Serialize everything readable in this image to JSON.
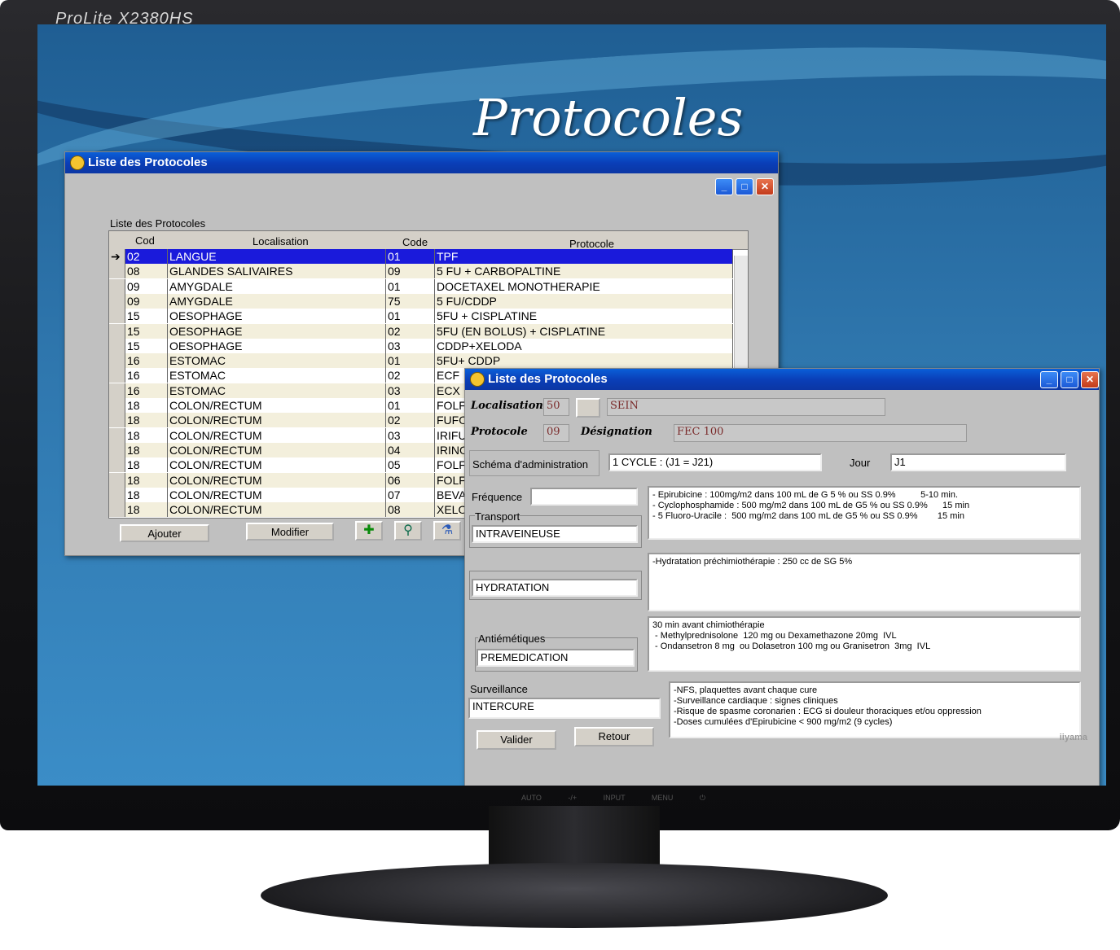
{
  "monitor": {
    "brand": "ProLite X2380HS",
    "vendor": "iiyama",
    "controls": "AUTO -/+ INPUT MENU ⏻"
  },
  "screen": {
    "title": "Protocoles"
  },
  "list_window": {
    "title": "Liste des Protocoles",
    "group_label": "Liste des Protocoles",
    "columns": [
      "Cod",
      "Localisation",
      "Code",
      "Protocole"
    ],
    "rows": [
      {
        "code": "02",
        "localisation": "LANGUE",
        "code2": "01",
        "protocole": "TPF",
        "selected": true
      },
      {
        "code": "08",
        "localisation": "GLANDES SALIVAIRES",
        "code2": "09",
        "protocole": "5 FU + CARBOPALTINE"
      },
      {
        "code": "09",
        "localisation": "AMYGDALE",
        "code2": "01",
        "protocole": "DOCETAXEL MONOTHERAPIE"
      },
      {
        "code": "09",
        "localisation": "AMYGDALE",
        "code2": "75",
        "protocole": "5 FU/CDDP"
      },
      {
        "code": "15",
        "localisation": "OESOPHAGE",
        "code2": "01",
        "protocole": "5FU + CISPLATINE"
      },
      {
        "code": "15",
        "localisation": "OESOPHAGE",
        "code2": "02",
        "protocole": "5FU (EN BOLUS) + CISPLATINE"
      },
      {
        "code": "15",
        "localisation": "OESOPHAGE",
        "code2": "03",
        "protocole": "CDDP+XELODA"
      },
      {
        "code": "16",
        "localisation": "ESTOMAC",
        "code2": "01",
        "protocole": "5FU+ CDDP"
      },
      {
        "code": "16",
        "localisation": "ESTOMAC",
        "code2": "02",
        "protocole": "ECF"
      },
      {
        "code": "16",
        "localisation": "ESTOMAC",
        "code2": "03",
        "protocole": "ECX"
      },
      {
        "code": "18",
        "localisation": "COLON/RECTUM",
        "code2": "01",
        "protocole": "FOLFO"
      },
      {
        "code": "18",
        "localisation": "COLON/RECTUM",
        "code2": "02",
        "protocole": "FUFO"
      },
      {
        "code": "18",
        "localisation": "COLON/RECTUM",
        "code2": "03",
        "protocole": "IRIFU"
      },
      {
        "code": "18",
        "localisation": "COLON/RECTUM",
        "code2": "04",
        "protocole": "IRINO"
      },
      {
        "code": "18",
        "localisation": "COLON/RECTUM",
        "code2": "05",
        "protocole": "FOLFO"
      },
      {
        "code": "18",
        "localisation": "COLON/RECTUM",
        "code2": "06",
        "protocole": "FOLFO"
      },
      {
        "code": "18",
        "localisation": "COLON/RECTUM",
        "code2": "07",
        "protocole": "BEVA"
      },
      {
        "code": "18",
        "localisation": "COLON/RECTUM",
        "code2": "08",
        "protocole": "XELO"
      }
    ],
    "buttons": {
      "add": "Ajouter",
      "modify": "Modifier"
    },
    "icons": [
      "add-icon",
      "filter-icon",
      "flask-icon"
    ]
  },
  "detail_window": {
    "title": "Liste des Protocoles",
    "localisation_label": "Localisation",
    "localisation_code": "50",
    "localisation_name": "SEIN",
    "protocole_label": "Protocole",
    "protocole_code": "09",
    "designation_label": "Désignation",
    "designation": "FEC 100",
    "schema_label": "Schéma d'administration",
    "schema_value": "1 CYCLE : (J1 = J21)",
    "jour_label": "Jour",
    "jour_value": "J1",
    "frequence_label": "Fréquence",
    "frequence_value": "",
    "transport_label": "Transport",
    "transport_value": "INTRAVEINEUSE",
    "hydratation_value": "HYDRATATION",
    "antiemetiques_label": "Antiémétiques",
    "antiemetiques_value": "PREMEDICATION",
    "surveillance_label": "Surveillance",
    "surveillance_value": "INTERCURE",
    "memo_drugs": "- Epirubicine : 100mg/m2 dans 100 mL de G 5 % ou SS 0.9%          5-10 min.\n- Cyclophosphamide : 500 mg/m2 dans 100 mL de G5 % ou SS 0.9%      15 min\n- 5 Fluoro-Uracile :  500 mg/m2 dans 100 mL de G5 % ou SS 0.9%        15 min",
    "memo_hydratation": "-Hydratation préchimiothérapie : 250 cc de SG 5%",
    "memo_premed": "30 min avant chimiothérapie\n - Methylprednisolone  120 mg ou Dexamethazone 20mg  IVL\n - Ondansetron 8 mg  ou Dolasetron 100 mg ou Granisetron  3mg  IVL",
    "memo_surveillance": "-NFS, plaquettes avant chaque cure\n-Surveillance cardiaque : signes cliniques\n-Risque de spasme coronarien : ECG si douleur thoraciques et/ou oppression\n-Doses cumulées d'Epirubicine < 900 mg/m2 (9 cycles)",
    "buttons": {
      "validate": "Valider",
      "back": "Retour"
    }
  }
}
